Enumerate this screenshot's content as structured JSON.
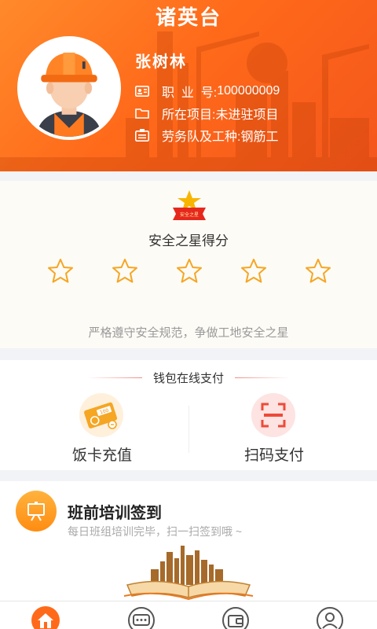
{
  "header": {
    "app_title": "诸英台",
    "user_name": "张树林",
    "rows": [
      {
        "label": "职  业  号:",
        "value": "100000009",
        "icon": "id-card-icon"
      },
      {
        "label": "所在项目:",
        "value": "未进驻项目",
        "icon": "folder-icon"
      },
      {
        "label": "劳务队及工种:",
        "value": "钢筋工",
        "icon": "badge-icon"
      }
    ]
  },
  "safety": {
    "medal_text": "安全之星",
    "title": "安全之星得分",
    "stars_filled": 0,
    "stars_total": 5,
    "slogan": "严格遵守安全规范，争做工地安全之星"
  },
  "wallet": {
    "title": "钱包在线支付",
    "items": [
      {
        "label": "饭卡充值",
        "icon": "meal-card-icon"
      },
      {
        "label": "扫码支付",
        "icon": "scan-icon"
      }
    ]
  },
  "training": {
    "title": "班前培训签到",
    "subtitle": "每日班组培训完毕，扫一扫签到哦 ~",
    "icon": "training-board-icon"
  },
  "nav": {
    "items": [
      {
        "name": "home",
        "icon": "home-icon",
        "active": true
      },
      {
        "name": "message",
        "icon": "chat-icon",
        "active": false
      },
      {
        "name": "wallet",
        "icon": "wallet-icon",
        "active": false
      },
      {
        "name": "profile",
        "icon": "user-icon",
        "active": false
      }
    ]
  },
  "colors": {
    "accent": "#ff6a1a",
    "star": "#f5a623",
    "nav_active": "#ff6a1a",
    "nav_inactive": "#555555"
  }
}
